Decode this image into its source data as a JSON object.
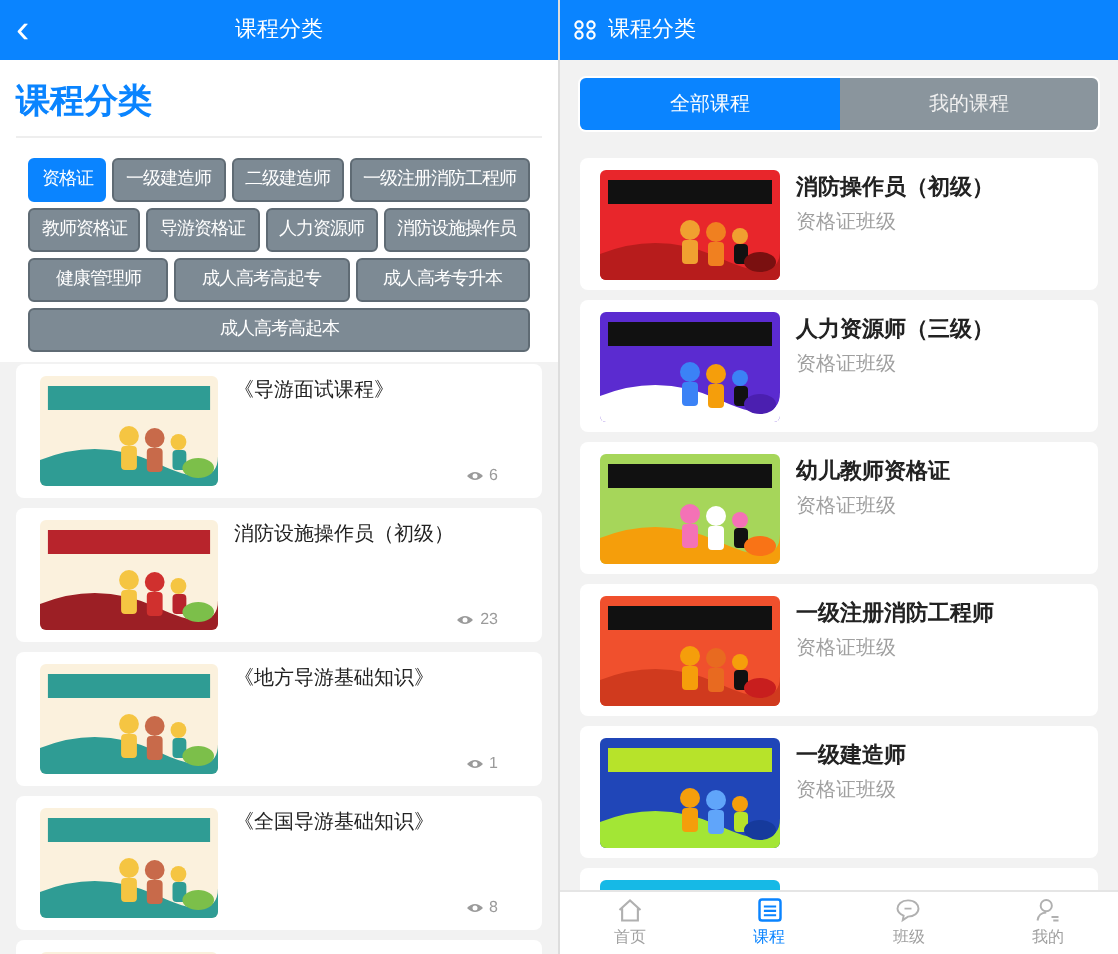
{
  "left_screen": {
    "header": {
      "back": "‹",
      "title": "课程分类"
    },
    "heading": "课程分类",
    "chips": [
      {
        "label": "资格证",
        "selected": true
      },
      {
        "label": "一级建造师",
        "selected": false
      },
      {
        "label": "二级建造师",
        "selected": false
      },
      {
        "label": "一级注册消防工程师",
        "selected": false
      },
      {
        "label": "教师资格证",
        "selected": false
      },
      {
        "label": "导游资格证",
        "selected": false
      },
      {
        "label": "人力资源师",
        "selected": false
      },
      {
        "label": "消防设施操作员",
        "selected": false
      },
      {
        "label": "健康管理师",
        "selected": false
      },
      {
        "label": "成人高考高起专",
        "selected": false
      },
      {
        "label": "成人高考专升本",
        "selected": false
      },
      {
        "label": "成人高考高起本",
        "selected": false
      }
    ],
    "courses": [
      {
        "title": "《导游面试课程》",
        "views": "6"
      },
      {
        "title": "消防设施操作员（初级）",
        "views": "23"
      },
      {
        "title": "《地方导游基础知识》",
        "views": "1"
      },
      {
        "title": "《全国导游基础知识》",
        "views": "8"
      }
    ]
  },
  "right_screen": {
    "header": {
      "title": "课程分类"
    },
    "tabs": [
      {
        "label": "全部课程",
        "selected": true
      },
      {
        "label": "我的课程",
        "selected": false
      }
    ],
    "courses": [
      {
        "title": "消防操作员（初级）",
        "subtitle": "资格证班级"
      },
      {
        "title": "人力资源师（三级）",
        "subtitle": "资格证班级"
      },
      {
        "title": "幼儿教师资格证",
        "subtitle": "资格证班级"
      },
      {
        "title": "一级注册消防工程师",
        "subtitle": "资格证班级"
      },
      {
        "title": "一级建造师",
        "subtitle": "资格证班级"
      }
    ],
    "nav": [
      {
        "label": "首页",
        "selected": false
      },
      {
        "label": "课程",
        "selected": true
      },
      {
        "label": "班级",
        "selected": false
      },
      {
        "label": "我的",
        "selected": false
      }
    ]
  }
}
